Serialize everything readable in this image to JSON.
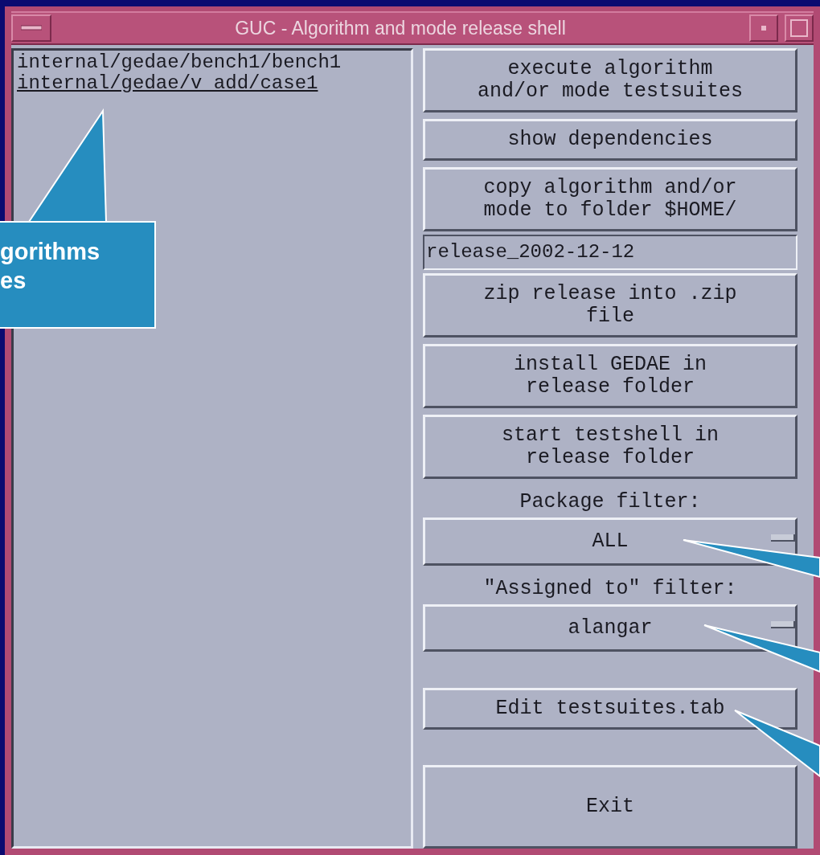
{
  "window": {
    "title": "GUC - Algorithm and mode release shell"
  },
  "testsuites": [
    {
      "path": "internal/gedae/bench1/bench1",
      "selected": false
    },
    {
      "path": "internal/gedae/v add/case1",
      "selected": true
    }
  ],
  "actions": [
    {
      "kind": "button",
      "lines": [
        "execute algorithm",
        "and/or mode testsuites"
      ]
    },
    {
      "kind": "button",
      "lines": [
        "show dependencies"
      ]
    },
    {
      "kind": "button",
      "lines": [
        "copy algorithm and/or",
        "mode to folder $HOME/"
      ]
    },
    {
      "kind": "field",
      "value": "release_2002-12-12"
    },
    {
      "kind": "button",
      "lines": [
        "zip release into .zip",
        "file"
      ]
    },
    {
      "kind": "button",
      "lines": [
        "install GEDAE in",
        "release folder"
      ]
    },
    {
      "kind": "button",
      "lines": [
        "start testshell in",
        "release folder"
      ]
    },
    {
      "kind": "label",
      "lines": [
        "Package filter:"
      ]
    },
    {
      "kind": "dropdown",
      "value": "ALL"
    },
    {
      "kind": "label",
      "lines": [
        "\"Assigned to\" filter:"
      ]
    },
    {
      "kind": "dropdown",
      "value": "alangar"
    },
    {
      "kind": "spacer"
    },
    {
      "kind": "button",
      "lines": [
        "Edit testsuites.tab"
      ]
    },
    {
      "kind": "spacer"
    },
    {
      "kind": "exit",
      "lines": [
        "Exit"
      ]
    }
  ],
  "callout": {
    "lines": [
      "gorithms",
      "es"
    ]
  }
}
